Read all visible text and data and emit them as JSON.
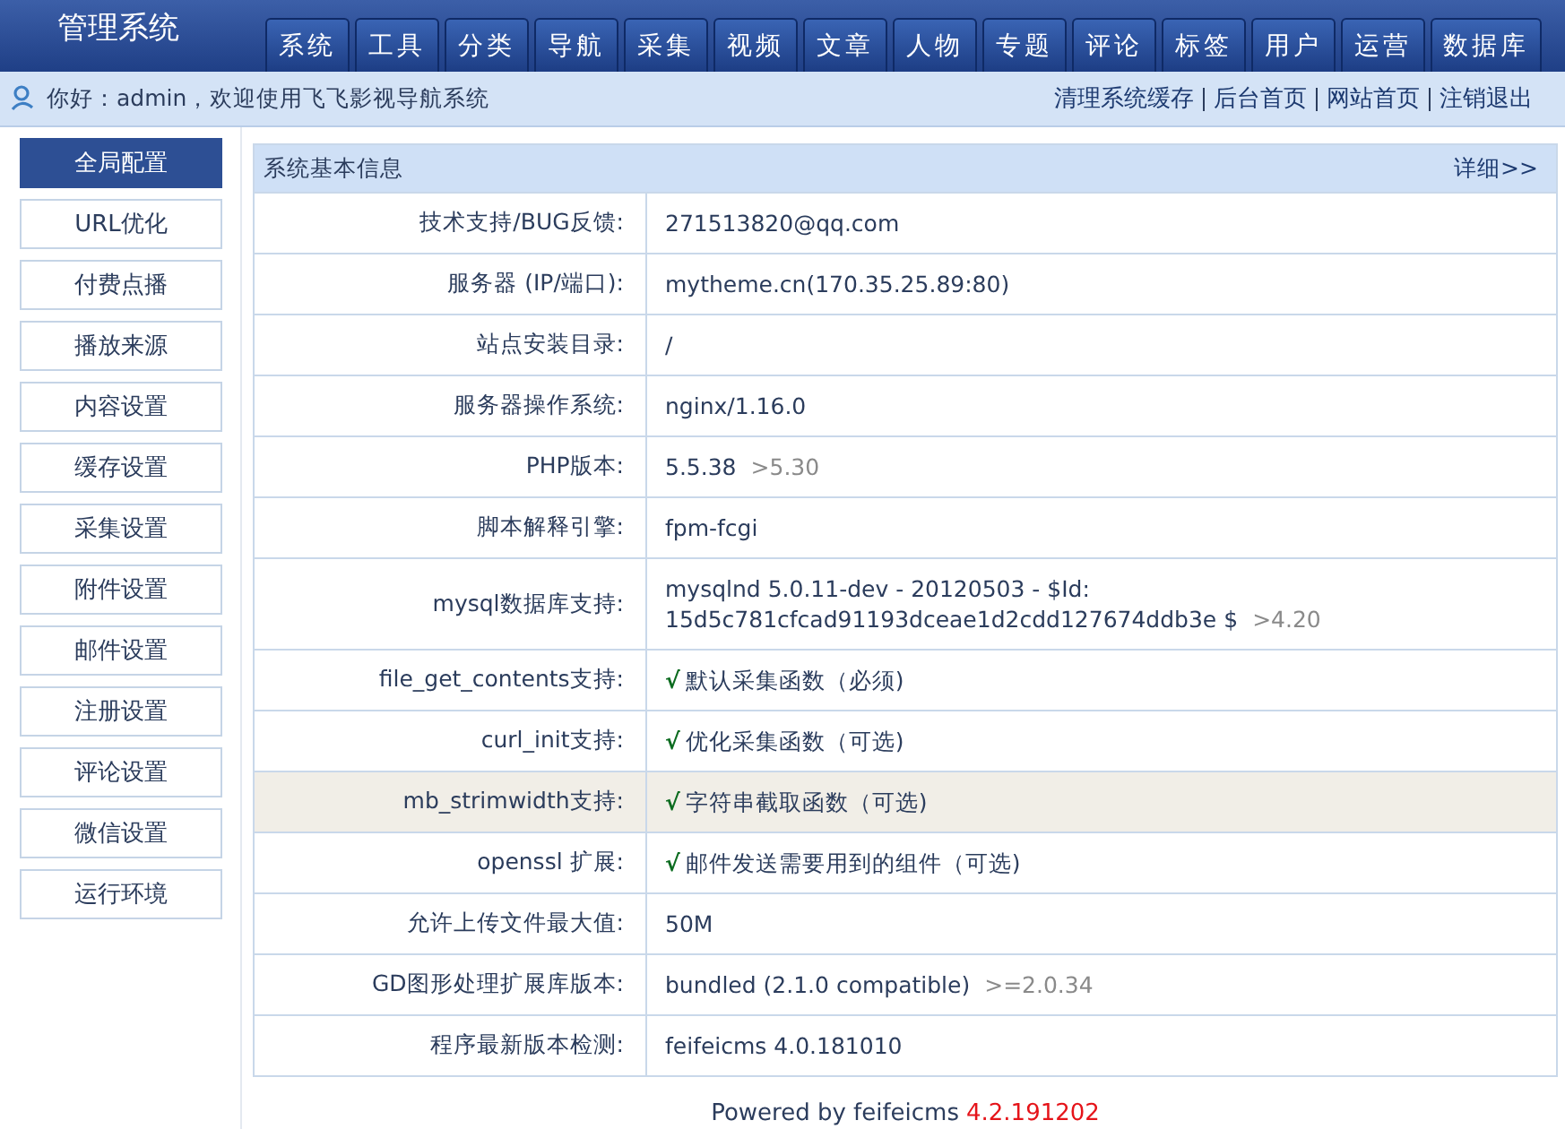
{
  "header": {
    "title": "管理系统",
    "tabs": [
      "系统",
      "工具",
      "分类",
      "导航",
      "采集",
      "视频",
      "文章",
      "人物",
      "专题",
      "评论",
      "标签",
      "用户",
      "运营",
      "数据库"
    ]
  },
  "subbar": {
    "greeting": "你好：admin，欢迎使用飞飞影视导航系统",
    "links": [
      "清理系统缓存",
      "后台首页",
      "网站首页",
      "注销退出"
    ]
  },
  "sidebar": {
    "items": [
      {
        "label": "全局配置",
        "selected": true
      },
      {
        "label": "URL优化",
        "selected": false
      },
      {
        "label": "付费点播",
        "selected": false
      },
      {
        "label": "播放来源",
        "selected": false
      },
      {
        "label": "内容设置",
        "selected": false
      },
      {
        "label": "缓存设置",
        "selected": false
      },
      {
        "label": "采集设置",
        "selected": false
      },
      {
        "label": "附件设置",
        "selected": false
      },
      {
        "label": "邮件设置",
        "selected": false
      },
      {
        "label": "注册设置",
        "selected": false
      },
      {
        "label": "评论设置",
        "selected": false
      },
      {
        "label": "微信设置",
        "selected": false
      },
      {
        "label": "运行环境",
        "selected": false
      }
    ]
  },
  "panel": {
    "title": "系统基本信息",
    "more": "详细>>",
    "rows": [
      {
        "label": "技术支持/BUG反馈:",
        "value": "271513820@qq.com",
        "highlighted": false
      },
      {
        "label": "服务器 (IP/端口):",
        "value": "mytheme.cn(170.35.25.89:80)",
        "highlighted": false
      },
      {
        "label": "站点安装目录:",
        "value": "/",
        "highlighted": false
      },
      {
        "label": "服务器操作系统:",
        "value": "nginx/1.16.0",
        "highlighted": false
      },
      {
        "label": "PHP版本:",
        "value": "5.5.38",
        "hint": ">5.30",
        "highlighted": false
      },
      {
        "label": "脚本解释引擎:",
        "value": "fpm-fcgi",
        "highlighted": false
      },
      {
        "label": "mysql数据库支持:",
        "value": "mysqlnd 5.0.11-dev - 20120503 - $Id: 15d5c781cfcad91193dceae1d2cdd127674ddb3e $",
        "hint": ">4.20",
        "highlighted": false
      },
      {
        "label": "file_get_contents支持:",
        "check": "√",
        "value": "默认采集函数（必须)",
        "highlighted": false
      },
      {
        "label": "curl_init支持:",
        "check": "√",
        "value": "优化采集函数（可选)",
        "highlighted": false
      },
      {
        "label": "mb_strimwidth支持:",
        "check": "√",
        "value": "字符串截取函数（可选)",
        "highlighted": true
      },
      {
        "label": "openssl 扩展:",
        "check": "√",
        "value": "邮件发送需要用到的组件（可选)",
        "highlighted": false
      },
      {
        "label": "允许上传文件最大值:",
        "value": "50M",
        "highlighted": false
      },
      {
        "label": "GD图形处理扩展库版本:",
        "value": "bundled (2.1.0 compatible)",
        "hint": ">=2.0.34",
        "highlighted": false
      },
      {
        "label": "程序最新版本检测:",
        "value": "feifeicms 4.0.181010",
        "highlighted": false
      }
    ]
  },
  "footer": {
    "text": "Powered by feifeicms",
    "version": "4.2.191202"
  }
}
